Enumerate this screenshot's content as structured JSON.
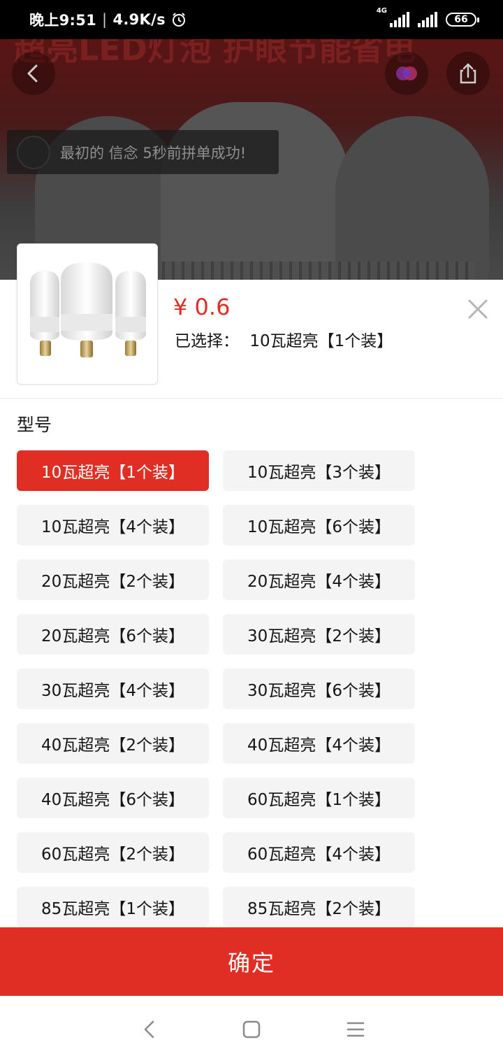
{
  "status_bar": {
    "time": "晚上9:51",
    "speed": "4.9K/s",
    "network": "4G",
    "battery": "66"
  },
  "hero": {
    "title": "超亮LED灯泡 护眼节能省电",
    "toast_text": "最初的  信念 5秒前拼单成功!"
  },
  "product": {
    "price": "¥ 0.6",
    "selected_label": "已选择：",
    "selected_value": "10瓦超亮【1个装】"
  },
  "section_title": "型号",
  "options": [
    {
      "label": "10瓦超亮【1个装】",
      "selected": true
    },
    {
      "label": "10瓦超亮【3个装】",
      "selected": false
    },
    {
      "label": "10瓦超亮【4个装】",
      "selected": false
    },
    {
      "label": "10瓦超亮【6个装】",
      "selected": false
    },
    {
      "label": "20瓦超亮【2个装】",
      "selected": false
    },
    {
      "label": "20瓦超亮【4个装】",
      "selected": false
    },
    {
      "label": "20瓦超亮【6个装】",
      "selected": false
    },
    {
      "label": "30瓦超亮【2个装】",
      "selected": false
    },
    {
      "label": "30瓦超亮【4个装】",
      "selected": false
    },
    {
      "label": "30瓦超亮【6个装】",
      "selected": false
    },
    {
      "label": "40瓦超亮【2个装】",
      "selected": false
    },
    {
      "label": "40瓦超亮【4个装】",
      "selected": false
    },
    {
      "label": "40瓦超亮【6个装】",
      "selected": false
    },
    {
      "label": "60瓦超亮【1个装】",
      "selected": false
    },
    {
      "label": "60瓦超亮【2个装】",
      "selected": false
    },
    {
      "label": "60瓦超亮【4个装】",
      "selected": false
    },
    {
      "label": "85瓦超亮【1个装】",
      "selected": false
    },
    {
      "label": "85瓦超亮【2个装】",
      "selected": false
    }
  ],
  "confirm_label": "确定",
  "colors": {
    "accent": "#e02e24",
    "option_bg": "#f4f4f4"
  },
  "icons": {
    "back": "back-arrow-icon",
    "share": "share-icon",
    "logo": "app-logo-icon",
    "close": "close-icon"
  }
}
